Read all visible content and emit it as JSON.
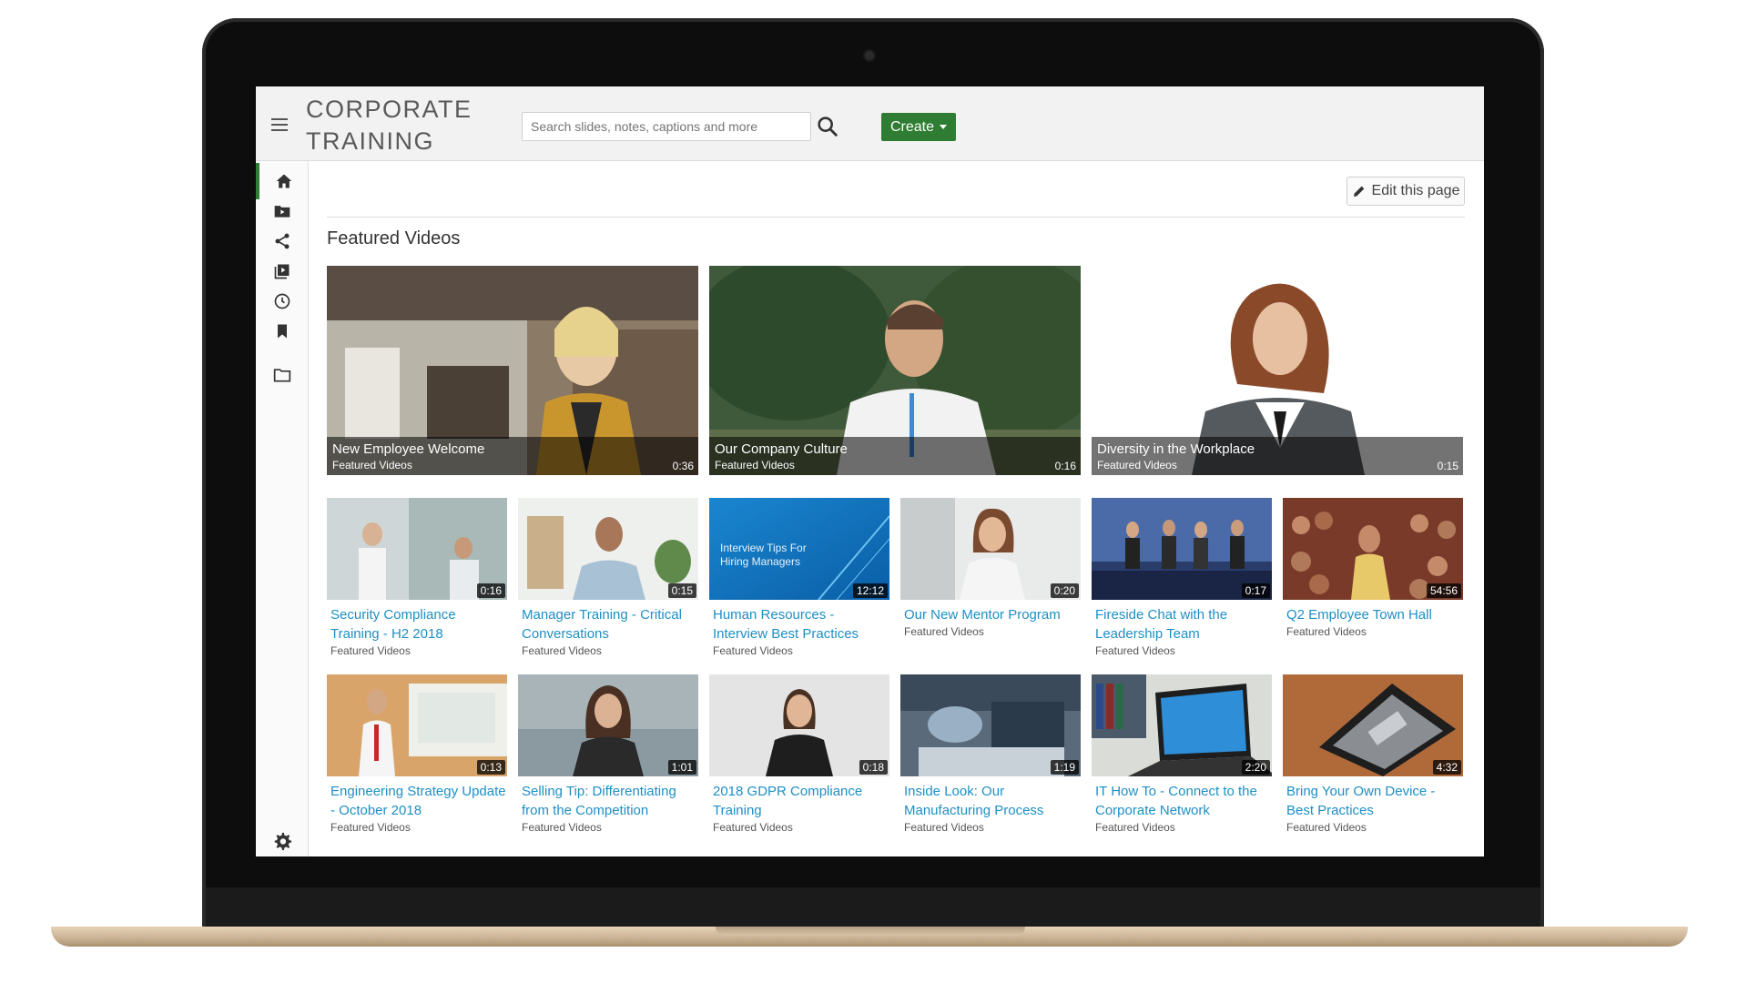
{
  "app": {
    "brand_line1": "CORPORATE",
    "brand_line2": "TRAINING"
  },
  "search": {
    "placeholder": "Search slides, notes, captions and more"
  },
  "toolbar": {
    "create_label": "Create"
  },
  "page": {
    "edit_label": "Edit this page",
    "section_title": "Featured Videos"
  },
  "sidebar": {
    "items": [
      {
        "icon": "home-icon"
      },
      {
        "icon": "folder-video-icon"
      },
      {
        "icon": "share-icon"
      },
      {
        "icon": "playlist-icon"
      },
      {
        "icon": "history-icon"
      },
      {
        "icon": "bookmark-icon"
      },
      {
        "icon": "folder-icon"
      }
    ],
    "settings_icon": "gear-icon"
  },
  "featured": [
    {
      "title": "New Employee Welcome",
      "folder": "Featured Videos",
      "duration": "0:36"
    },
    {
      "title": "Our Company Culture",
      "folder": "Featured Videos",
      "duration": "0:16"
    },
    {
      "title": "Diversity in the Workplace",
      "folder": "Featured Videos",
      "duration": "0:15"
    }
  ],
  "videos_row1": [
    {
      "title": "Security Compliance Training - H2 2018",
      "folder": "Featured Videos",
      "duration": "0:16"
    },
    {
      "title": "Manager Training - Critical Conversations",
      "folder": "Featured Videos",
      "duration": "0:15"
    },
    {
      "title": "Human Resources - Interview Best Practices",
      "folder": "Featured Videos",
      "duration": "12:12",
      "thumb_text": "Interview Tips For Hiring Managers"
    },
    {
      "title": "Our New Mentor Program",
      "folder": "Featured Videos",
      "duration": "0:20"
    },
    {
      "title": "Fireside Chat with the Leadership Team",
      "folder": "Featured Videos",
      "duration": "0:17"
    },
    {
      "title": "Q2 Employee Town Hall",
      "folder": "Featured Videos",
      "duration": "54:56"
    }
  ],
  "videos_row2": [
    {
      "title": "Engineering Strategy Update - October 2018",
      "folder": "Featured Videos",
      "duration": "0:13"
    },
    {
      "title": "Selling Tip: Differentiating from the Competition",
      "folder": "Featured Videos",
      "duration": "1:01"
    },
    {
      "title": "2018 GDPR Compliance Training",
      "folder": "Featured Videos",
      "duration": "0:18"
    },
    {
      "title": "Inside Look: Our Manufacturing Process",
      "folder": "Featured Videos",
      "duration": "1:19"
    },
    {
      "title": "IT How To - Connect to the Corporate Network",
      "folder": "Featured Videos",
      "duration": "2:20"
    },
    {
      "title": "Bring Your Own Device - Best Practices",
      "folder": "Featured Videos",
      "duration": "4:32"
    }
  ],
  "colors": {
    "accent_green": "#2e7d32",
    "link_blue": "#1e8fc4",
    "topbar_bg": "#f2f2f2"
  }
}
